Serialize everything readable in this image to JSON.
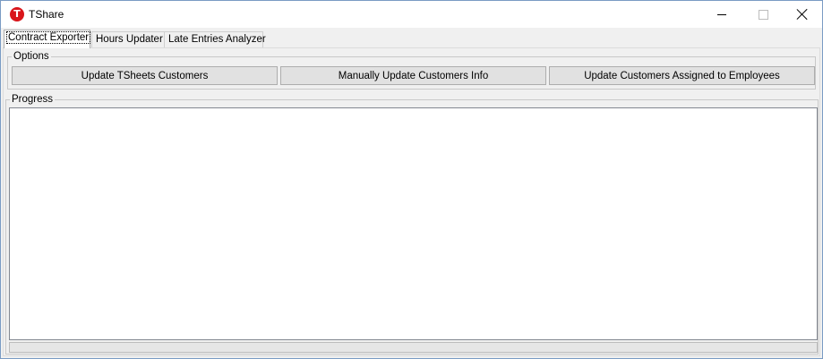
{
  "window": {
    "title": "TShare",
    "icon": "t-logo-icon",
    "icon_glyph": "T",
    "accent_color": "#d9161b"
  },
  "tabs": [
    {
      "label": "Contract Exporter",
      "active": true
    },
    {
      "label": "Hours Updater",
      "active": false
    },
    {
      "label": "Late Entries Analyzer",
      "active": false
    }
  ],
  "options": {
    "label": "Options",
    "buttons": [
      {
        "label": "Update TSheets Customers"
      },
      {
        "label": "Manually Update Customers Info"
      },
      {
        "label": "Update Customers Assigned to Employees"
      }
    ]
  },
  "progress": {
    "label": "Progress",
    "log_text": "",
    "progress_value": 0
  }
}
